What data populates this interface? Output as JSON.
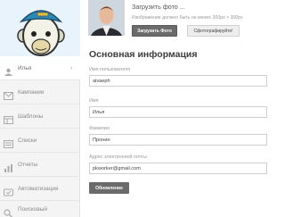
{
  "sidebar": {
    "user_label": "Илья",
    "items": [
      {
        "label": "Кампании",
        "icon": "envelope-icon"
      },
      {
        "label": "Шаблоны",
        "icon": "template-icon"
      },
      {
        "label": "Списки",
        "icon": "list-icon"
      },
      {
        "label": "Отчеты",
        "icon": "reports-icon"
      },
      {
        "label": "Автоматизация",
        "icon": "automation-icon"
      },
      {
        "label": "Поисковый",
        "icon": "search-icon"
      }
    ]
  },
  "photo": {
    "title": "Загрузить фото ...",
    "hint": "Изображение должно быть не менее 300px × 300px",
    "upload_button": "Загрузить Фото",
    "snapshot_button": "Сфотографируйте!"
  },
  "form": {
    "title": "Основная информация",
    "username_label": "Имя пользователя",
    "username_value": "aivaeph",
    "firstname_label": "Имя",
    "firstname_value": "Илья",
    "lastname_label": "Фамилия",
    "lastname_value": "Пронин",
    "email_label": "Адрес электронной почты",
    "email_value": "pkworker@gmail.com",
    "update_button": "Обновление"
  }
}
